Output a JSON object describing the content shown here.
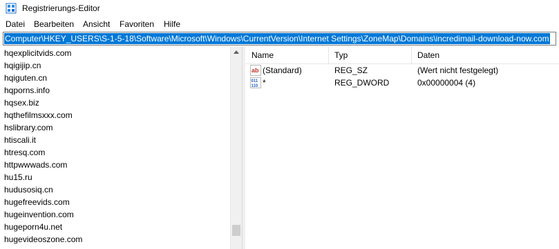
{
  "window": {
    "title": "Registrierungs-Editor"
  },
  "menu": [
    "Datei",
    "Bearbeiten",
    "Ansicht",
    "Favoriten",
    "Hilfe"
  ],
  "address": "Computer\\HKEY_USERS\\S-1-5-18\\Software\\Microsoft\\Windows\\CurrentVersion\\Internet Settings\\ZoneMap\\Domains\\incredimail-download-now.com",
  "tree": {
    "items": [
      "hqexplicitvids.com",
      "hqigijip.cn",
      "hqiguten.cn",
      "hqporns.info",
      "hqsex.biz",
      "hqthefilmsxxx.com",
      "hslibrary.com",
      "htiscali.it",
      "htresq.com",
      "httpwwwads.com",
      "hu15.ru",
      "hudusosiq.cn",
      "hugefreevids.com",
      "hugeinvention.com",
      "hugeporn4u.net",
      "hugevideoszone.com"
    ]
  },
  "list": {
    "columns": [
      "Name",
      "Typ",
      "Daten"
    ],
    "rows": [
      {
        "name": "(Standard)",
        "type": "REG_SZ",
        "data": "(Wert nicht festgelegt)",
        "icon": "string-value-icon"
      },
      {
        "name": "*",
        "type": "REG_DWORD",
        "data": "0x00000004 (4)",
        "icon": "binary-value-icon"
      }
    ]
  },
  "colors": {
    "selection": "#0078d7",
    "icon_ab": "#c0392b",
    "icon_bin": "#1f5fbf"
  }
}
